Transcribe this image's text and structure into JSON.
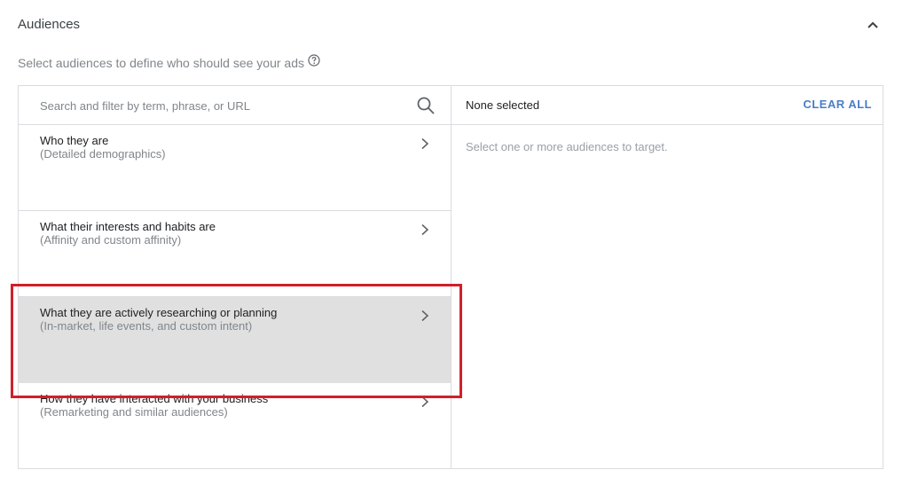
{
  "section": {
    "title": "Audiences",
    "subtitle": "Select audiences to define who should see your ads"
  },
  "search": {
    "placeholder": "Search and filter by term, phrase, or URL",
    "value": ""
  },
  "categories": [
    {
      "title": "Who they are",
      "desc": "(Detailed demographics)"
    },
    {
      "title": "What their interests and habits are",
      "desc": "(Affinity and custom affinity)"
    },
    {
      "title": "What they are actively researching or planning",
      "desc": "(In-market, life events, and custom intent)"
    },
    {
      "title": "How they have interacted with your business",
      "desc": "(Remarketing and similar audiences)"
    }
  ],
  "selection": {
    "status": "None selected",
    "clear_label": "CLEAR ALL",
    "empty_message": "Select one or more audiences to target."
  },
  "colors": {
    "highlight": "#d0202b",
    "accent": "#4a7ec8",
    "active_row": "#e0e0e0"
  },
  "icons": {
    "collapse": "chevron-up-icon",
    "help": "help-circle-icon",
    "search": "search-icon",
    "row": "chevron-right-icon"
  }
}
